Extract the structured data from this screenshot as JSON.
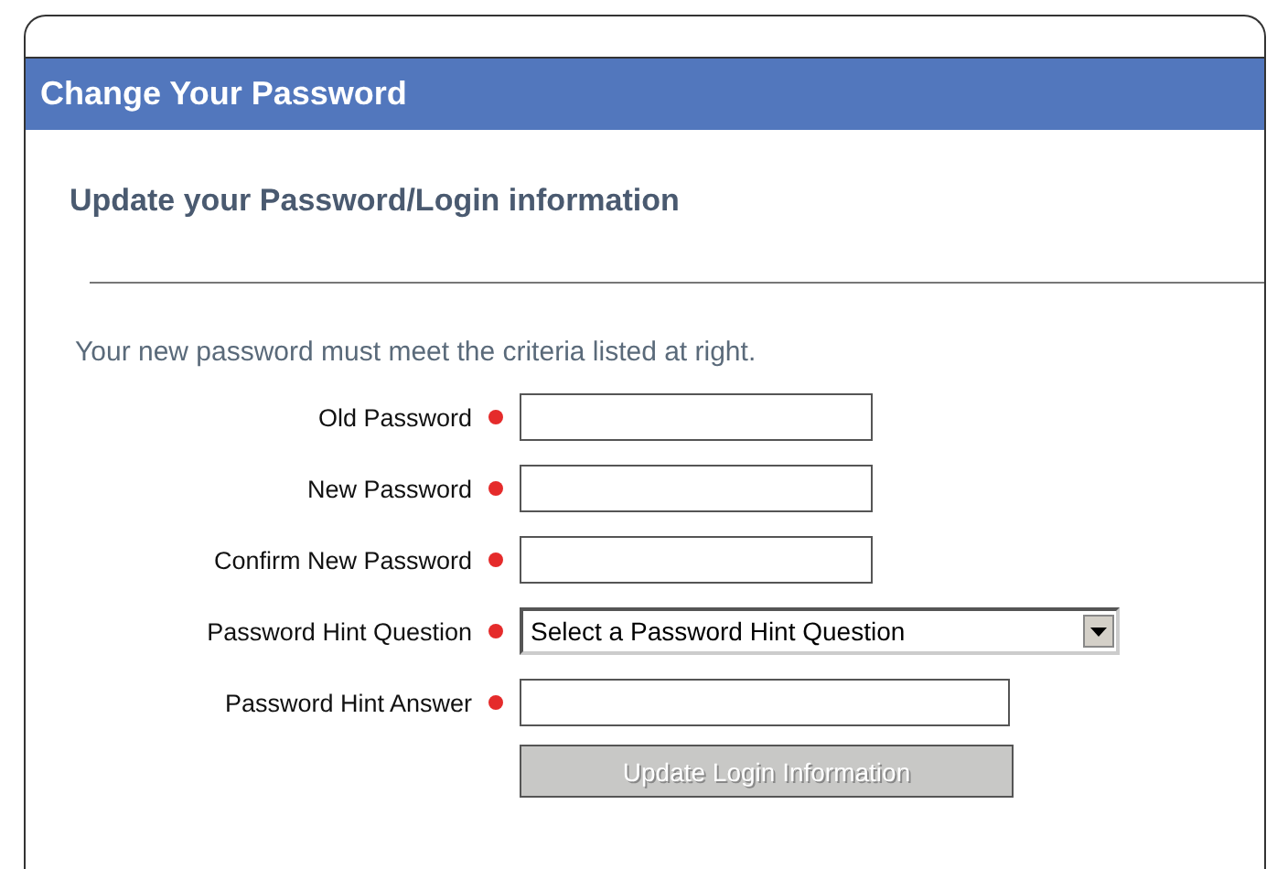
{
  "panel": {
    "title": "Change Your Password"
  },
  "subtitle": "Update your Password/Login information",
  "intro": "Your new password must meet the criteria listed at right.",
  "fields": [
    {
      "kind": "text",
      "label": "Old Password",
      "required": true
    },
    {
      "kind": "text",
      "label": "New Password",
      "required": true
    },
    {
      "kind": "text",
      "label": "Confirm New Password",
      "required": true
    },
    {
      "kind": "select",
      "label": "Password Hint Question",
      "required": true,
      "value": "Select a Password Hint Question"
    },
    {
      "kind": "answer",
      "label": "Password Hint Answer",
      "required": true
    }
  ],
  "submit": {
    "label": "Update Login Information",
    "disabled": true
  }
}
